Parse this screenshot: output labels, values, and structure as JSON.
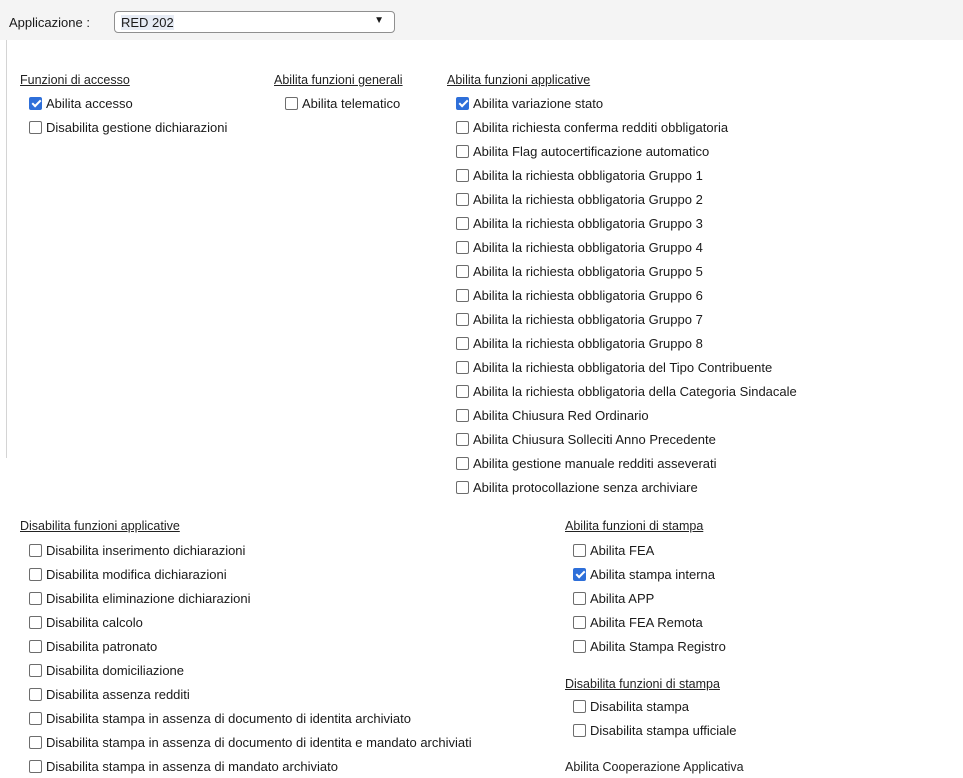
{
  "header": {
    "app_label": "Applicazione :",
    "app_value": "RED 202",
    "dropdown_arrow": "▼"
  },
  "sections": {
    "accesso": {
      "title": "Funzioni di accesso",
      "items": [
        {
          "label": "Abilita accesso",
          "checked": true
        },
        {
          "label": "Disabilita gestione dichiarazioni",
          "checked": false
        }
      ]
    },
    "generali": {
      "title": "Abilita funzioni generali",
      "items": [
        {
          "label": "Abilita telematico",
          "checked": false
        }
      ]
    },
    "applicative": {
      "title": "Abilita funzioni applicative",
      "items": [
        {
          "label": "Abilita variazione stato",
          "checked": true
        },
        {
          "label": "Abilita richiesta conferma redditi obbligatoria",
          "checked": false
        },
        {
          "label": "Abilita Flag autocertificazione automatico",
          "checked": false
        },
        {
          "label": "Abilita la richiesta obbligatoria Gruppo 1",
          "checked": false
        },
        {
          "label": "Abilita la richiesta obbligatoria Gruppo 2",
          "checked": false
        },
        {
          "label": "Abilita la richiesta obbligatoria Gruppo 3",
          "checked": false
        },
        {
          "label": "Abilita la richiesta obbligatoria Gruppo 4",
          "checked": false
        },
        {
          "label": "Abilita la richiesta obbligatoria Gruppo 5",
          "checked": false
        },
        {
          "label": "Abilita la richiesta obbligatoria Gruppo 6",
          "checked": false
        },
        {
          "label": "Abilita la richiesta obbligatoria Gruppo 7",
          "checked": false
        },
        {
          "label": "Abilita la richiesta obbligatoria Gruppo 8",
          "checked": false
        },
        {
          "label": "Abilita la richiesta obbligatoria del Tipo Contribuente",
          "checked": false
        },
        {
          "label": "Abilita la richiesta obbligatoria della Categoria Sindacale",
          "checked": false
        },
        {
          "label": "Abilita Chiusura Red Ordinario",
          "checked": false
        },
        {
          "label": "Abilita Chiusura Solleciti Anno Precedente",
          "checked": false
        },
        {
          "label": "Abilita gestione manuale redditi asseverati",
          "checked": false
        },
        {
          "label": "Abilita protocollazione senza archiviare",
          "checked": false
        }
      ]
    },
    "disabilita_applicative": {
      "title": "Disabilita funzioni applicative",
      "items": [
        {
          "label": "Disabilita inserimento dichiarazioni",
          "checked": false
        },
        {
          "label": "Disabilita modifica dichiarazioni",
          "checked": false
        },
        {
          "label": "Disabilita eliminazione dichiarazioni",
          "checked": false
        },
        {
          "label": "Disabilita calcolo",
          "checked": false
        },
        {
          "label": "Disabilita patronato",
          "checked": false
        },
        {
          "label": "Disabilita domiciliazione",
          "checked": false
        },
        {
          "label": "Disabilita assenza redditi",
          "checked": false
        },
        {
          "label": "Disabilita stampa in assenza di documento di identita archiviato",
          "checked": false
        },
        {
          "label": "Disabilita stampa in assenza di documento di identita e mandato archiviati",
          "checked": false
        },
        {
          "label": "Disabilita stampa in assenza di mandato archiviato",
          "checked": false
        }
      ]
    },
    "stampa": {
      "title": "Abilita funzioni di stampa",
      "items": [
        {
          "label": "Abilita FEA",
          "checked": false
        },
        {
          "label": "Abilita stampa interna",
          "checked": true
        },
        {
          "label": "Abilita APP",
          "checked": false
        },
        {
          "label": "Abilita FEA Remota",
          "checked": false
        },
        {
          "label": "Abilita Stampa Registro",
          "checked": false
        }
      ]
    },
    "disabilita_stampa": {
      "title": "Disabilita funzioni di stampa",
      "items": [
        {
          "label": "Disabilita stampa",
          "checked": false
        },
        {
          "label": "Disabilita stampa ufficiale",
          "checked": false
        }
      ]
    },
    "cooperazione": {
      "title": "Abilita Cooperazione Applicativa"
    }
  },
  "colors": {
    "checkbox_checked": "#2e6fd9",
    "topbar_background": "#f4f4f4"
  }
}
